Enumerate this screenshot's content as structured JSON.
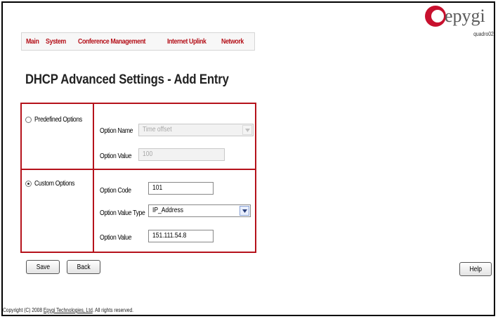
{
  "nav": {
    "items": [
      "Main",
      "System",
      "Conference Management",
      "Internet Uplink",
      "Network"
    ]
  },
  "logo": {
    "brand": "epygi",
    "model": "quadro02"
  },
  "page": {
    "title": "DHCP Advanced Settings - Add Entry"
  },
  "predefined": {
    "label": "Predefined Options",
    "selected": false,
    "option_name_label": "Option Name",
    "option_name_value": "Time offset",
    "option_value_label": "Option Value",
    "option_value_value": "100"
  },
  "custom": {
    "label": "Custom Options",
    "selected": true,
    "option_code_label": "Option Code",
    "option_code_value": "101",
    "option_value_type_label": "Option Value Type",
    "option_value_type_value": "IP_Address",
    "option_value_label": "Option Value",
    "option_value_value": "151.111.54.8"
  },
  "buttons": {
    "save": "Save",
    "back": "Back",
    "help": "Help"
  },
  "footer": {
    "prefix": "Copyright (C) 2008 ",
    "link": "Epygi Technologies, Ltd",
    "suffix": ". All rights reserved."
  },
  "colors": {
    "accent": "#b5121b",
    "logo_red": "#c8102e"
  }
}
